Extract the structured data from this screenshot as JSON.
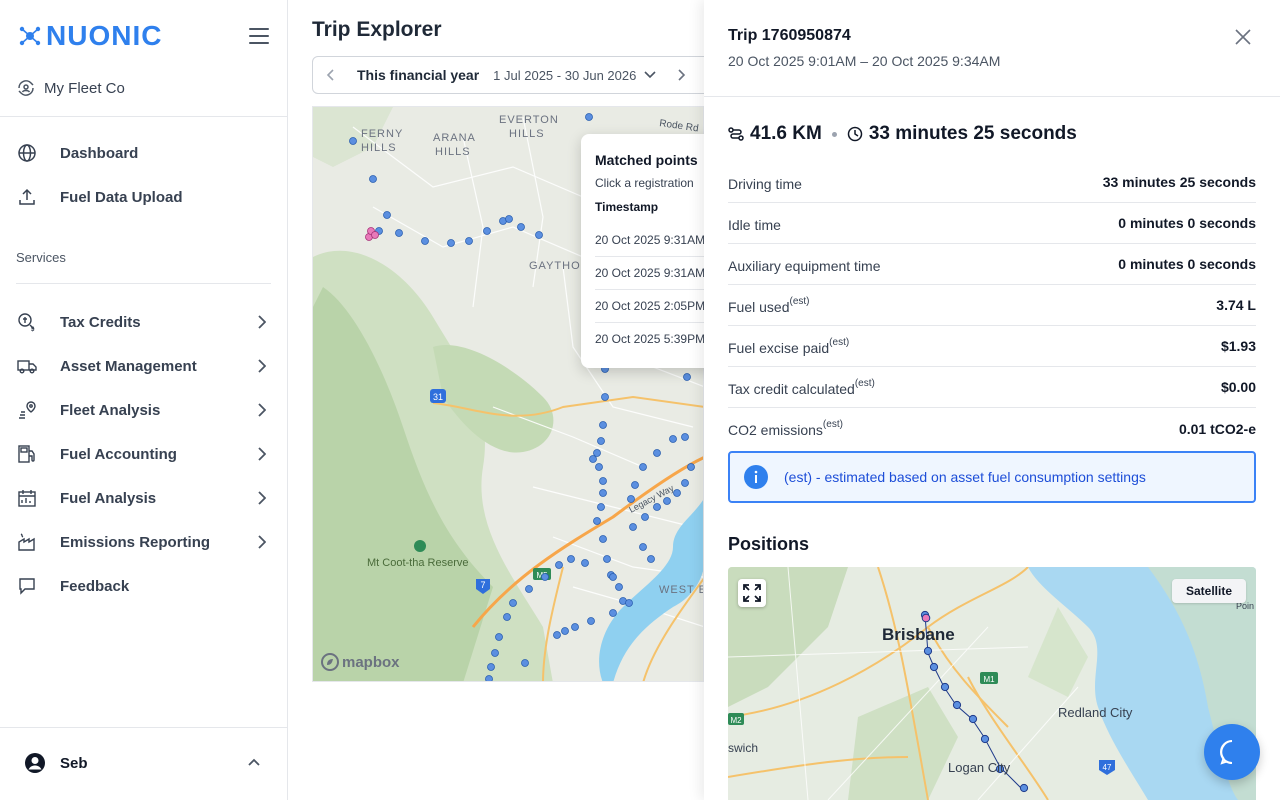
{
  "brand": {
    "name": "NUONIC",
    "color": "#2f80ed"
  },
  "org": {
    "name": "My Fleet Co"
  },
  "nav_top": [
    {
      "label": "Dashboard",
      "icon": "globe-icon"
    },
    {
      "label": "Fuel Data Upload",
      "icon": "upload-icon"
    }
  ],
  "services_label": "Services",
  "nav_services": [
    {
      "label": "Tax Credits",
      "icon": "tax-credit-icon"
    },
    {
      "label": "Asset Management",
      "icon": "truck-icon"
    },
    {
      "label": "Fleet Analysis",
      "icon": "route-pin-icon"
    },
    {
      "label": "Fuel Accounting",
      "icon": "fuel-pump-icon"
    },
    {
      "label": "Fuel Analysis",
      "icon": "calendar-chart-icon"
    },
    {
      "label": "Emissions Reporting",
      "icon": "factory-icon"
    }
  ],
  "feedback": {
    "label": "Feedback",
    "icon": "chat-bubble-icon"
  },
  "user": {
    "name": "Seb"
  },
  "main": {
    "title": "Trip Explorer",
    "date_picker": {
      "label": "This financial year",
      "range_start": "1 Jul 2025",
      "range_sep": "-",
      "range_end": "30 Jun 2026"
    },
    "map_labels": {
      "ferny_hills": "FERNY HILLS",
      "arana_hills": "ARANA HILLS",
      "everton_hills": "EVERTON HILLS",
      "gaythorne": "GAYTHO",
      "rode_rd": "Rode Rd",
      "coot_tha": "Mt Coot-tha Reserve",
      "legacy_way": "Legacy Way",
      "west_end": "WEST E",
      "route_31": "31",
      "route_7": "7",
      "route_m5": "M5",
      "mapbox": "mapbox"
    },
    "popup": {
      "title": "Matched points",
      "subtitle": "Click a registration",
      "header": "Timestamp",
      "rows": [
        "20 Oct 2025 9:31AM",
        "20 Oct 2025 9:31AM",
        "20 Oct 2025 2:05PM",
        "20 Oct 2025 5:39PM"
      ]
    }
  },
  "drawer": {
    "title": "Trip 1760950874",
    "subtitle": "20 Oct 2025 9:01AM – 20 Oct 2025 9:34AM",
    "distance": "41.6 KM",
    "duration": "33 minutes 25 seconds",
    "stats": [
      {
        "label": "Driving time",
        "est": "",
        "value": "33 minutes 25 seconds"
      },
      {
        "label": "Idle time",
        "est": "",
        "value": "0 minutes 0 seconds"
      },
      {
        "label": "Auxiliary equipment time",
        "est": "",
        "value": "0 minutes 0 seconds"
      },
      {
        "label": "Fuel used",
        "est": "(est)",
        "value": "3.74 L"
      },
      {
        "label": "Fuel excise paid",
        "est": "(est)",
        "value": "$1.93"
      },
      {
        "label": "Tax credit calculated",
        "est": "(est)",
        "value": "$0.00"
      },
      {
        "label": "CO2 emissions",
        "est": "(est)",
        "value": "0.01 tCO2-e"
      }
    ],
    "info_text": "(est) - estimated based on asset fuel consumption settings",
    "positions_title": "Positions",
    "satellite_label": "Satellite",
    "map_labels": {
      "brisbane": "Brisbane",
      "redland": "Redland City",
      "logan": "Logan City",
      "ipswich": "swich",
      "m1": "M1",
      "m2": "M2",
      "r47": "47",
      "point": "Poin"
    }
  }
}
